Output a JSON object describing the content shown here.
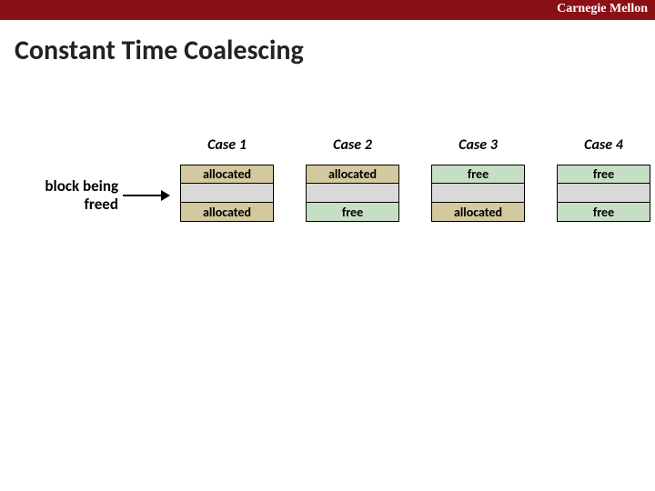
{
  "brand": "Carnegie Mellon",
  "title": "Constant Time Coalescing",
  "side_label_line1": "block being",
  "side_label_line2": "freed",
  "cases": [
    {
      "title": "Case 1",
      "top": "allocated",
      "bottom": "allocated",
      "top_cls": "bg-tan",
      "bot_cls": "bg-tan"
    },
    {
      "title": "Case 2",
      "top": "allocated",
      "bottom": "free",
      "top_cls": "bg-tan",
      "bot_cls": "bg-green"
    },
    {
      "title": "Case 3",
      "top": "free",
      "bottom": "allocated",
      "top_cls": "bg-green",
      "bot_cls": "bg-tan"
    },
    {
      "title": "Case 4",
      "top": "free",
      "bottom": "free",
      "top_cls": "bg-green",
      "bot_cls": "bg-green"
    }
  ]
}
